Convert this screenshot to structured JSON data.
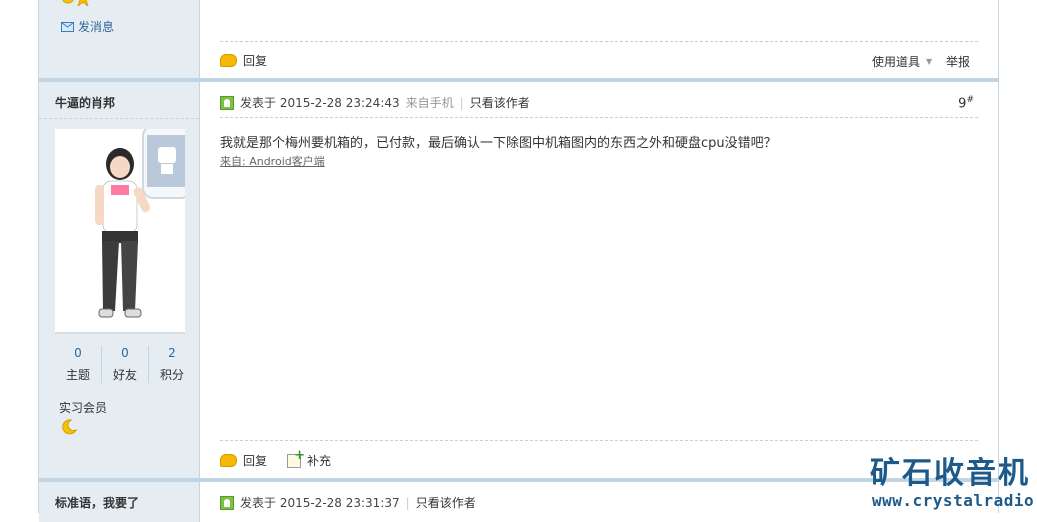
{
  "prev_post": {
    "send_message": "发消息",
    "reply": "回复",
    "use_tool": "使用道具",
    "report": "举报"
  },
  "post": {
    "author": "牛逼的肖邦",
    "posted_at": "发表于 2015-2-28 23:24:43",
    "source": "来自手机",
    "only_author": "只看该作者",
    "floor": "9",
    "floor_suffix": "#",
    "content": "我就是那个梅州要机箱的，已付款，最后确认一下除图中机箱图内的东西之外和硬盘cpu没错吧？",
    "client_link": "来自: Android客户端",
    "stats": [
      {
        "value": "0",
        "label": "主题"
      },
      {
        "value": "0",
        "label": "好友"
      },
      {
        "value": "2",
        "label": "积分"
      }
    ],
    "rank": "实习会员",
    "reply": "回复",
    "supplement": "补充"
  },
  "next_post": {
    "author": "标准语，我要了",
    "posted_at": "发表于 2015-2-28 23:31:37",
    "only_author": "只看该作者"
  },
  "watermark": {
    "title": "矿石收音机",
    "url": "www.crystalradio.cn"
  },
  "colors": {
    "sidebar_bg": "#e5edf2",
    "border": "#c2d5e3",
    "link": "#336699",
    "watermark": "#1d5a8a"
  }
}
